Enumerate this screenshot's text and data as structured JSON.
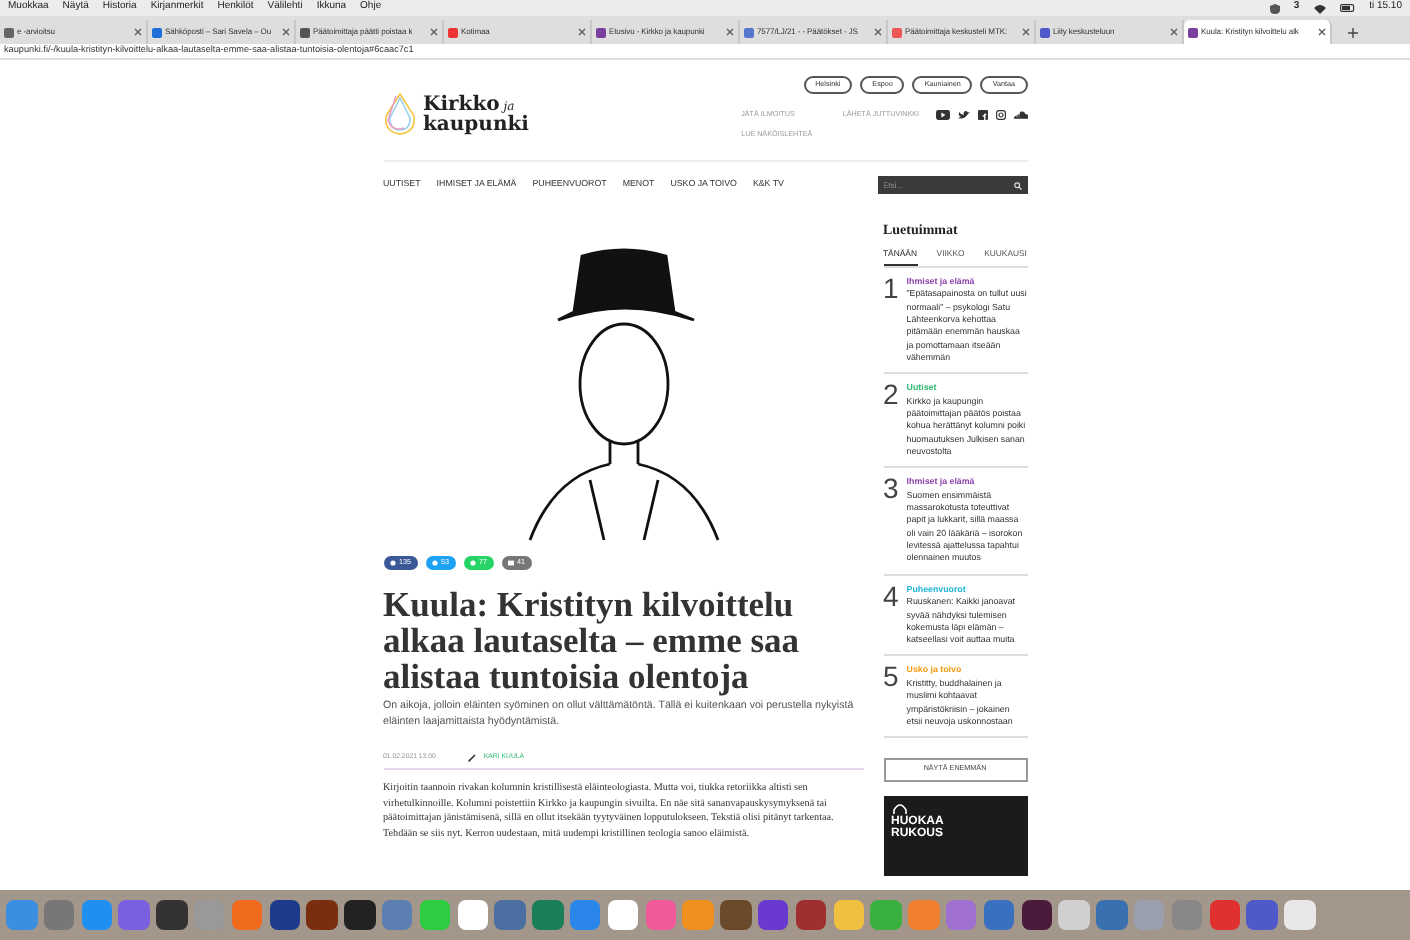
{
  "menubar": {
    "items": [
      "Muokkaa",
      "Näytä",
      "Historia",
      "Kirjanmerkit",
      "Henkilöt",
      "Välilehti",
      "Ikkuna",
      "Ohje"
    ],
    "badge": "3",
    "clock": "ti 15.10"
  },
  "browser_tabs": [
    {
      "title": "e -arvioitsu",
      "selected": false
    },
    {
      "title": "Sähköposti – Sari Savela – Ou",
      "selected": false
    },
    {
      "title": "Päätoimittaja päätti poistaa k",
      "selected": false
    },
    {
      "title": "Kotimaa",
      "selected": false
    },
    {
      "title": "Etusivu - Kirkko ja kaupunki",
      "selected": false
    },
    {
      "title": "7577/LJ/21 - - Päätökset - JS",
      "selected": false
    },
    {
      "title": "Päätoimittaja keskusteli MTK:",
      "selected": false
    },
    {
      "title": "Liity keskusteluun",
      "selected": false
    },
    {
      "title": "Kuula: Kristityn kilvoittelu alk",
      "selected": true
    }
  ],
  "url": "kaupunki.fi/-/kuula-kristityn-kilvoittelu-alkaa-lautaselta-emme-saa-alistaa-tuntoisia-olentoja#6caac7c1",
  "site": {
    "logo": [
      "Kirkko",
      "ja",
      "kaupunki"
    ],
    "cities": [
      "Helsinki",
      "Espoo",
      "Kauniainen",
      "Vantaa"
    ],
    "links": [
      "JÄTÄ ILMOITUS",
      "LÄHETÄ JUTTUVINKKI",
      "LUE NÄKÖISLEHTEÄ"
    ],
    "nav": [
      "UUTISET",
      "IHMISET JA ELÄMÄ",
      "PUHEENVUOROT",
      "MENOT",
      "USKO JA TOIVO",
      "K&K TV"
    ],
    "search": {
      "placeholder": "Etsi..."
    }
  },
  "article": {
    "share_buttons": [
      {
        "kind": "facebook",
        "count": "135"
      },
      {
        "kind": "twitter",
        "count": "53"
      },
      {
        "kind": "whatsapp",
        "count": "77"
      },
      {
        "kind": "email",
        "count": "41"
      }
    ],
    "title": "Kuula: Kristityn kilvoittelu alkaa lautaselta – emme saa alistaa tuntoisia olentoja",
    "lead": "On aikoja, jolloin eläinten syöminen on ollut välttämätöntä. Tällä ei kuitenkaan voi perustella nykyistä eläinten laajamittaista hyödyntämistä.",
    "date": "01.02.2021 13:00",
    "author": "KARI KUULA",
    "body": "Kirjoitin taannoin rivakan kolumnin kristillisestä eläinteologiasta. Mutta voi, tiukka retoriikka altisti sen virhetulkinnoille. Kolumni poistettiin Kirkko ja kaupungin sivuilta. En näe sitä sananvapauskysymyksenä tai päätoimittajan jänistämisenä, sillä en ollut itsekään tyytyväinen lopputulokseen. Tekstiä olisi pitänyt tarkentaa. Tehdään se siis nyt. Kerron uudestaan, mitä uudempi kristillinen teologia sanoo eläimistä."
  },
  "sidebar": {
    "title": "Luetuimmat",
    "tabs": [
      {
        "label": "TÄNÄÄN",
        "selected": true
      },
      {
        "label": "VIIKKO",
        "selected": false
      },
      {
        "label": "KUUKAUSI",
        "selected": false
      }
    ],
    "items": [
      {
        "number": "1",
        "category": "Ihmiset ja elämä",
        "color": "#8e44ad",
        "title": "”Epätasapainosta on tullut uusi normaali” – psykologi Satu Lähteenkorva kehottaa pitämään enemmän hauskaa ja pomottamaan itseään vähemmän"
      },
      {
        "number": "2",
        "category": "Uutiset",
        "color": "#2eb872",
        "title": "Kirkko ja kaupungin päätoimittajan päätös poistaa kohua herättänyt kolumni poiki huomautuksen Julkisen sanan neuvostolta"
      },
      {
        "number": "3",
        "category": "Ihmiset ja elämä",
        "color": "#8e44ad",
        "title": "Suomen ensimmäistä massarokotusta toteuttivat papit ja lukkarit, sillä maassa oli vain 20 lääkäriä – isorokon levitessä ajattelussa tapahtui olennainen muutos"
      },
      {
        "number": "4",
        "category": "Puheenvuorot",
        "color": "#1fb5d6",
        "title": "Ruuskanen: Kaikki janoavat syvää nähdyksi tulemisen kokemusta läpi elämän – katseellasi voit auttaa muita"
      },
      {
        "number": "5",
        "category": "Usko ja toivo",
        "color": "#f39c12",
        "title": "Kristitty, buddhalainen ja muslimi kohtaavat ympäristökriisin – jokainen etsii neuvoja uskonnostaan"
      }
    ],
    "more_button": "NÄYTÄ ENEMMÄN",
    "ad": [
      "HUOKAA",
      "RUKOUS"
    ]
  }
}
